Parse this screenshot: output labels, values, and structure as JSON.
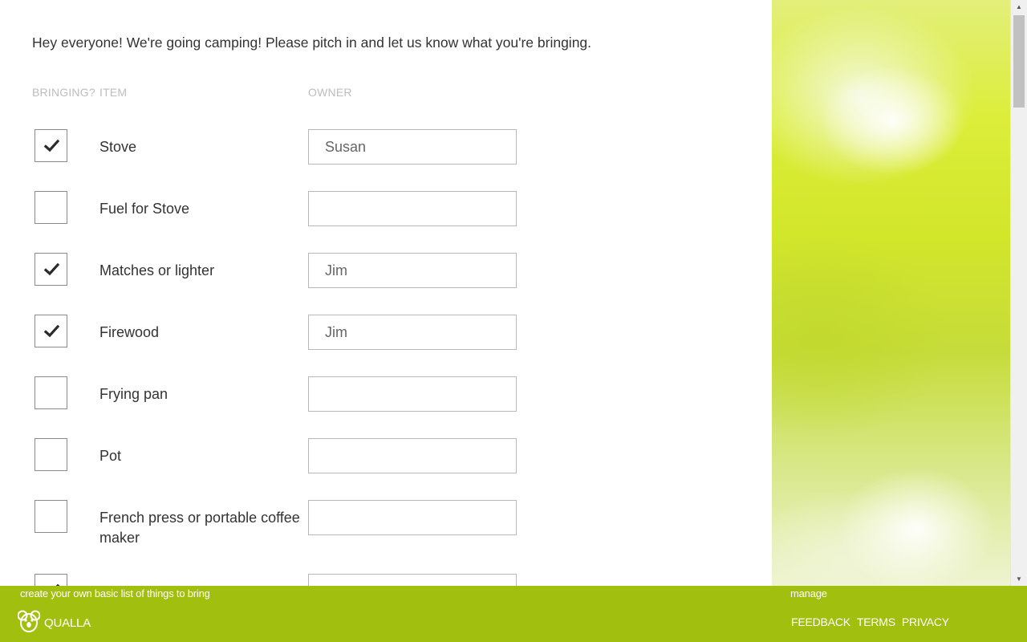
{
  "intro": "Hey everyone! We're going camping! Please pitch in and let us know what you're bringing.",
  "columns": {
    "bringing": "BRINGING?",
    "item": "ITEM",
    "owner": "OWNER"
  },
  "items": [
    {
      "label": "Stove",
      "checked": true,
      "owner": "Susan"
    },
    {
      "label": "Fuel for Stove",
      "checked": false,
      "owner": ""
    },
    {
      "label": "Matches or lighter",
      "checked": true,
      "owner": "Jim"
    },
    {
      "label": "Firewood",
      "checked": true,
      "owner": "Jim"
    },
    {
      "label": "Frying pan",
      "checked": false,
      "owner": ""
    },
    {
      "label": "Pot",
      "checked": false,
      "owner": ""
    },
    {
      "label": "French press or portable coffee maker",
      "checked": false,
      "owner": ""
    },
    {
      "label": "",
      "checked": true,
      "owner": ""
    }
  ],
  "footer": {
    "promo": "create your own basic list of things to bring",
    "manage": "manage",
    "brand": "QUALLA",
    "links": {
      "feedback": "FEEDBACK",
      "terms": "TERMS",
      "privacy": "PRIVACY"
    }
  },
  "colors": {
    "accent": "#a1bf0e",
    "text": "#333333",
    "muted": "#bdbdbd"
  },
  "icons": {
    "check": "check-icon",
    "logo": "koala-logo-icon"
  }
}
